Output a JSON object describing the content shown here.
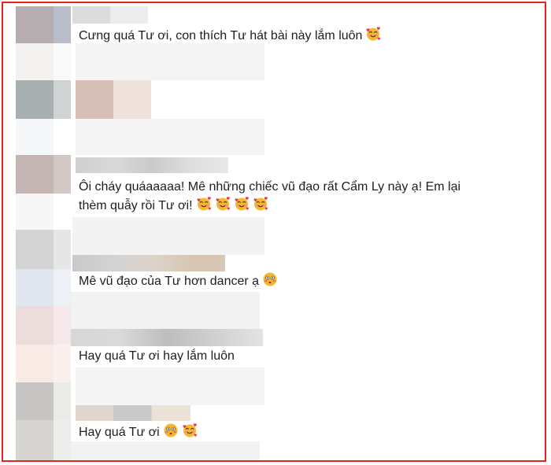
{
  "comments": [
    {
      "text": "Cưng quá Tư ơi, con thích Tư hát bài này lắm luôn",
      "emojis": [
        "smiling-face-with-hearts"
      ]
    },
    {
      "text_line1": "Ôi cháy quáaaaaa! Mê những chiếc vũ đạo rất Cẩm Ly này ạ! Em lại",
      "text_line2": "thèm quẫy rồi Tư ơi!",
      "emojis": [
        "smiling-face-with-hearts",
        "smiling-face-with-hearts",
        "smiling-face-with-hearts",
        "smiling-face-with-hearts"
      ]
    },
    {
      "text": "Mê vũ đạo của Tư hơn dancer ạ",
      "emojis": [
        "flushed-face"
      ]
    },
    {
      "text": "Hay quá Tư ơi hay lắm luôn",
      "emojis": []
    },
    {
      "text": "Hay quá Tư ơi",
      "emojis": [
        "flushed-face",
        "smiling-face-with-hearts"
      ]
    }
  ],
  "colors": {
    "frame_border": "#e8221b",
    "text": "#1c1e21",
    "emoji_face": "#f7b731",
    "emoji_heart": "#e8325a"
  }
}
